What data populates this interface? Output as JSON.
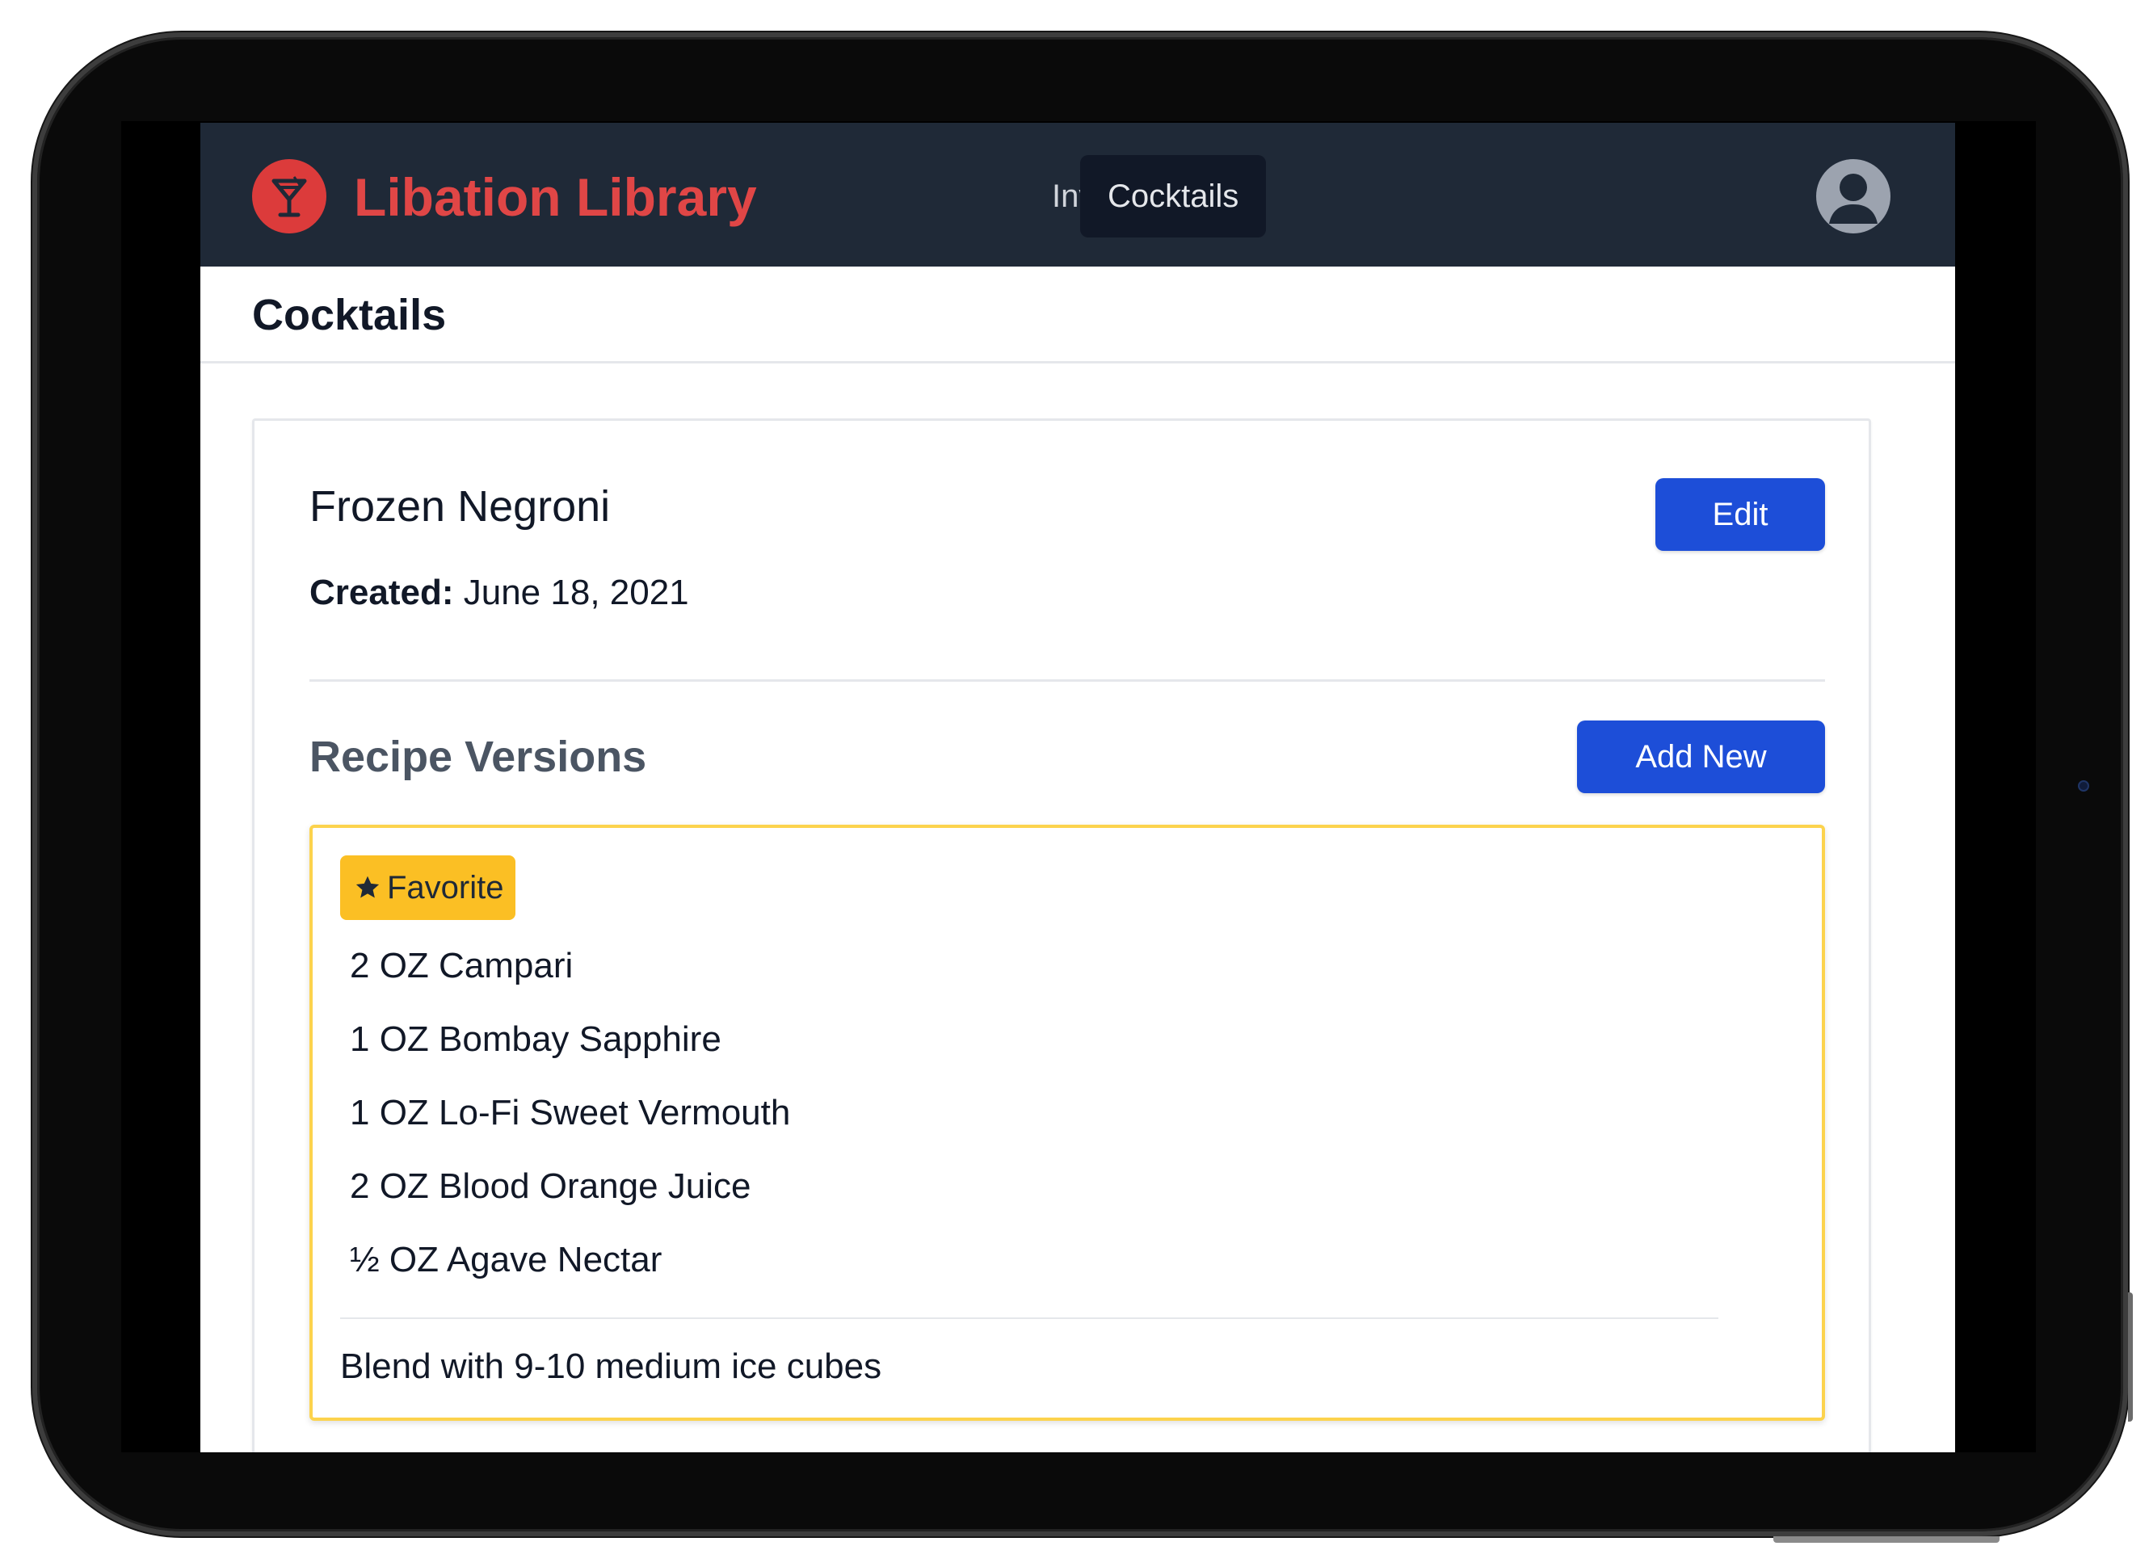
{
  "app": {
    "title": "Libation Library"
  },
  "nav": {
    "items": [
      {
        "label": "Inventory",
        "active": false
      },
      {
        "label": "Cocktails",
        "active": true
      }
    ]
  },
  "page": {
    "title": "Cocktails"
  },
  "cocktail": {
    "name": "Frozen Negroni",
    "created_label": "Created:",
    "created_date": "June 18, 2021",
    "edit_label": "Edit"
  },
  "recipe_versions": {
    "title": "Recipe Versions",
    "add_label": "Add New",
    "versions": [
      {
        "badge": "Favorite",
        "ingredients": [
          "2 OZ Campari",
          "1 OZ Bombay Sapphire",
          "1 OZ Lo-Fi Sweet Vermouth",
          "2 OZ Blood Orange Juice",
          "½ OZ Agave Nectar"
        ],
        "notes": "Blend with 9-10 medium ice cubes"
      }
    ]
  },
  "icons": {
    "logo": "cocktail-glass-icon",
    "profile": "user-avatar-icon",
    "favorite": "star-icon"
  },
  "colors": {
    "navbar": "#1f2937",
    "brand": "#e04646",
    "primary_button": "#1d4ed8",
    "favorite_badge": "#fbbf24",
    "favorite_border": "#fcd34d"
  }
}
